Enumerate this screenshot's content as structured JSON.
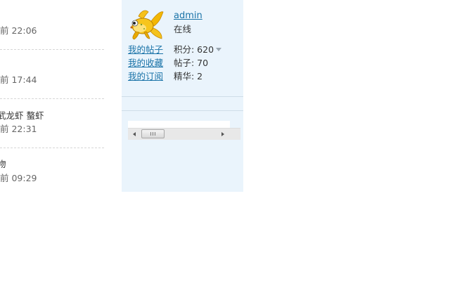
{
  "post_list": [
    {
      "title": "",
      "time": "前 22:06"
    },
    {
      "title": "",
      "time": "前 17:44"
    },
    {
      "title": "武龙虾 螯虾",
      "time": "前 22:31"
    },
    {
      "title": "物",
      "time": "前 09:29"
    }
  ],
  "user": {
    "avatar_icon": "goldfish-avatar-icon",
    "name": "admin",
    "status": "在线",
    "links": [
      "我的帖子",
      "我的收藏",
      "我的订阅"
    ],
    "stats": {
      "points_label": "积分: 620",
      "posts_label": "帖子: 70",
      "digest_label": "精华: 2"
    }
  },
  "colors": {
    "panel_bg": "#eaf4fc",
    "link": "#1a73a8"
  }
}
